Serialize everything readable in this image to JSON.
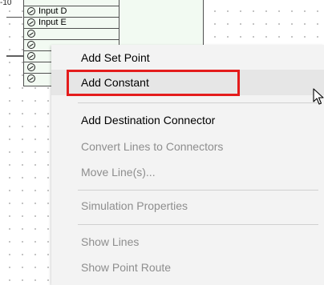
{
  "diagram": {
    "tick_label": "-10",
    "inputs": [
      "Input D",
      "Input E"
    ]
  },
  "context_menu": {
    "items": [
      {
        "label": "Add Set Point",
        "enabled": true
      },
      {
        "label": "Add Constant",
        "enabled": true,
        "highlighted": true
      },
      {
        "label": "Add Destination Connector",
        "enabled": true
      },
      {
        "label": "Convert Lines to Connectors",
        "enabled": false
      },
      {
        "label": "Move Line(s)...",
        "enabled": false
      },
      {
        "label": "Simulation Properties",
        "enabled": false
      },
      {
        "label": "Show Lines",
        "enabled": false
      },
      {
        "label": "Show Point Route",
        "enabled": false
      }
    ]
  },
  "colors": {
    "highlight_border": "#e41c1c",
    "menu_background": "#f3f3f3",
    "disabled_text": "#8e8e8e",
    "block_fill": "#f2faf2"
  }
}
